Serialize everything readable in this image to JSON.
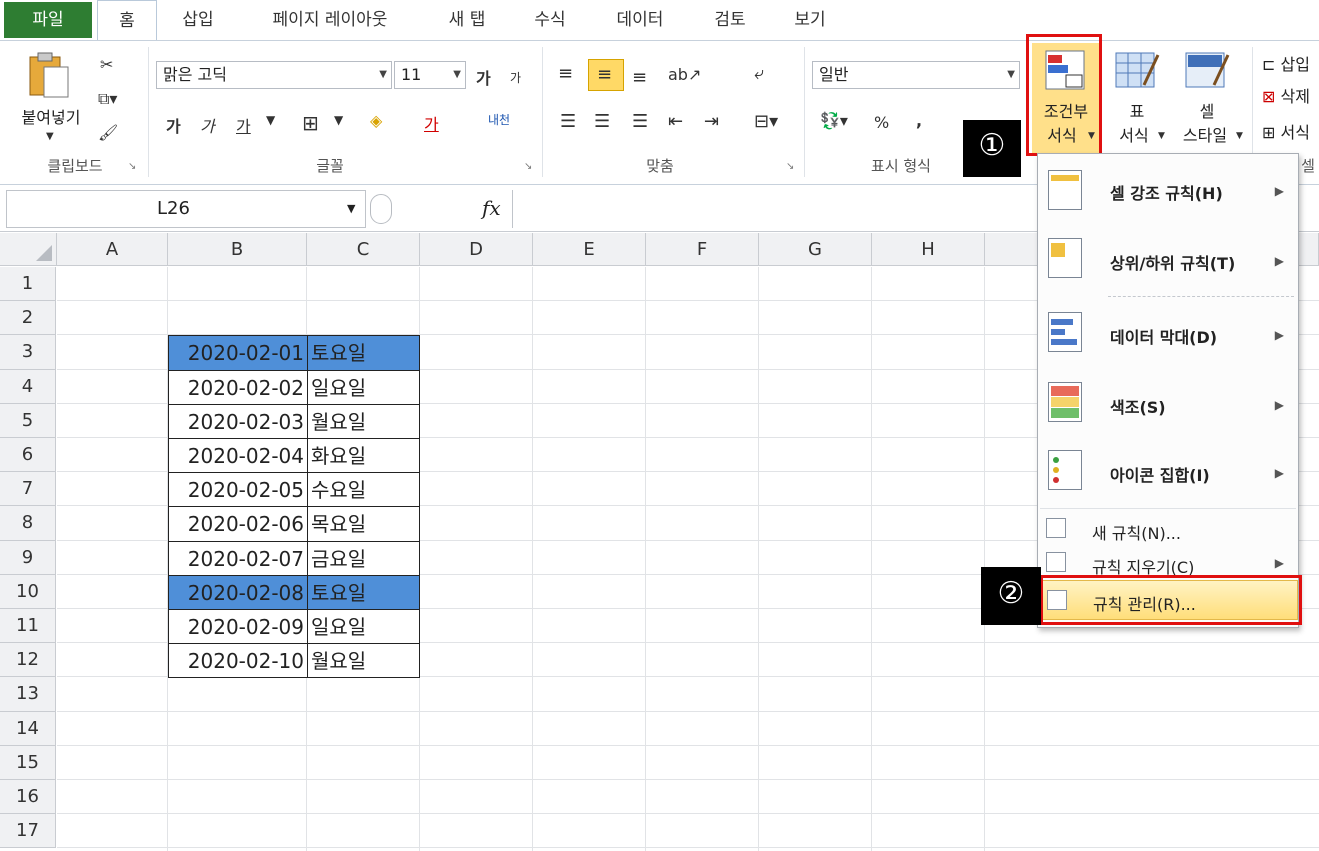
{
  "tabs": [
    "파일",
    "홈",
    "삽입",
    "페이지 레이아웃",
    "새 탭",
    "수식",
    "데이터",
    "검토",
    "보기"
  ],
  "ribbon": {
    "paste_label": "붙여넣기",
    "groups": [
      "클립보드",
      "글꼴",
      "맞춤",
      "표시 형식"
    ],
    "partial_group": "셀",
    "font_name": "맑은 고딕",
    "font_size": "11",
    "font_buttons": [
      "가",
      "가",
      "가",
      "가",
      "가",
      "내천"
    ],
    "number_format": "일반",
    "percent": "%",
    "comma": ",",
    "conditional_format": [
      "조건부",
      "서식"
    ],
    "table_format": [
      "표",
      "서식"
    ],
    "cell_style": [
      "셀",
      "스타일"
    ],
    "cell_actions": [
      "삽입",
      "삭제",
      "서식"
    ],
    "accent_red": "#e01010"
  },
  "badges": {
    "one": "①",
    "two": "②"
  },
  "formula_bar": {
    "name_box": "L26",
    "fx": "fx"
  },
  "columns": [
    "A",
    "B",
    "C",
    "D",
    "E",
    "F",
    "G",
    "H"
  ],
  "rows": [
    "1",
    "2",
    "3",
    "4",
    "5",
    "6",
    "7",
    "8",
    "9",
    "10",
    "11",
    "12",
    "13",
    "14",
    "15",
    "16",
    "17"
  ],
  "table": [
    {
      "date": "2020-02-01",
      "day": "토요일",
      "highlight": true
    },
    {
      "date": "2020-02-02",
      "day": "일요일",
      "highlight": false
    },
    {
      "date": "2020-02-03",
      "day": "월요일",
      "highlight": false
    },
    {
      "date": "2020-02-04",
      "day": "화요일",
      "highlight": false
    },
    {
      "date": "2020-02-05",
      "day": "수요일",
      "highlight": false
    },
    {
      "date": "2020-02-06",
      "day": "목요일",
      "highlight": false
    },
    {
      "date": "2020-02-07",
      "day": "금요일",
      "highlight": false
    },
    {
      "date": "2020-02-08",
      "day": "토요일",
      "highlight": true
    },
    {
      "date": "2020-02-09",
      "day": "일요일",
      "highlight": false
    },
    {
      "date": "2020-02-10",
      "day": "월요일",
      "highlight": false
    }
  ],
  "highlight_color": "#4f8fd8",
  "menu": {
    "items": [
      {
        "label": "셀 강조 규칙(H)"
      },
      {
        "label": "상위/하위 규칙(T)"
      },
      {
        "label": "데이터 막대(D)"
      },
      {
        "label": "색조(S)"
      },
      {
        "label": "아이콘 집합(I)"
      }
    ],
    "small_items": [
      {
        "label": "새 규칙(N)..."
      },
      {
        "label": "규칙 지우기(C)"
      },
      {
        "label": "규칙 관리(R)..."
      }
    ]
  }
}
